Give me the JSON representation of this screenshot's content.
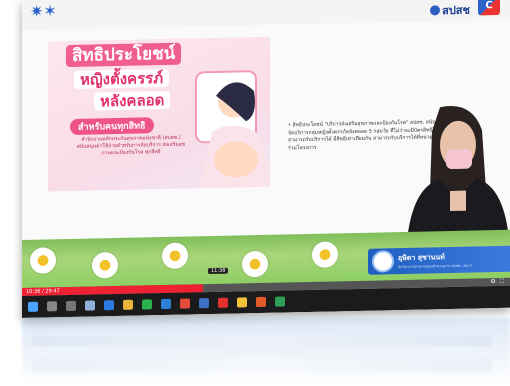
{
  "corner_logo": "✷✶",
  "header": {
    "agency_logo": "สปสช",
    "channel_badge": "C"
  },
  "poster": {
    "title": "สิทธิประโยชน์",
    "line2": "หญิงตั้งครรภ์",
    "line3": "หลังคลอด",
    "subtitle": "สำหรับคนทุกสิทธิ",
    "body": "สำนักงานหลักประกันสุขภาพแห่งชาติ (สปสช.) สนับสนุนค่าใช้จ่ายสำหรับการจัดบริการ ส่งเสริมสุขภาพและป้องกันโรค ทุกสิทธิ"
  },
  "slide_text": "• สิทธิประโยชน์ \"บริการส่งเสริมสุขภาพและป้องกันโรค\" สปสช. สนับสนุนการจัดบริการกลุ่มหญิงตั้งครรภ์หลังคลอด 5 กลุ่มวัย ที่ไม่ว่าจะมีบัตรสิทธิใด ก็สามารถรับบริการได้ มีสิทธิเท่าเทียมกัน สามารถรับบริการได้ที่หน่วยบริการที่ร่วมโครงการ",
  "nameplate": {
    "name": "อุษิดา สุชานนท์",
    "role": "นักวิชาการสาธารณสุขชำนาญการ สปสช. เขต 5"
  },
  "player": {
    "timestamp": "11:38",
    "elapsed": "10:36 / 29:47",
    "progress": 0.37
  },
  "colors": {
    "accent": "#ef5e8f",
    "brand": "#2b61c8",
    "progress": "#e23333"
  }
}
